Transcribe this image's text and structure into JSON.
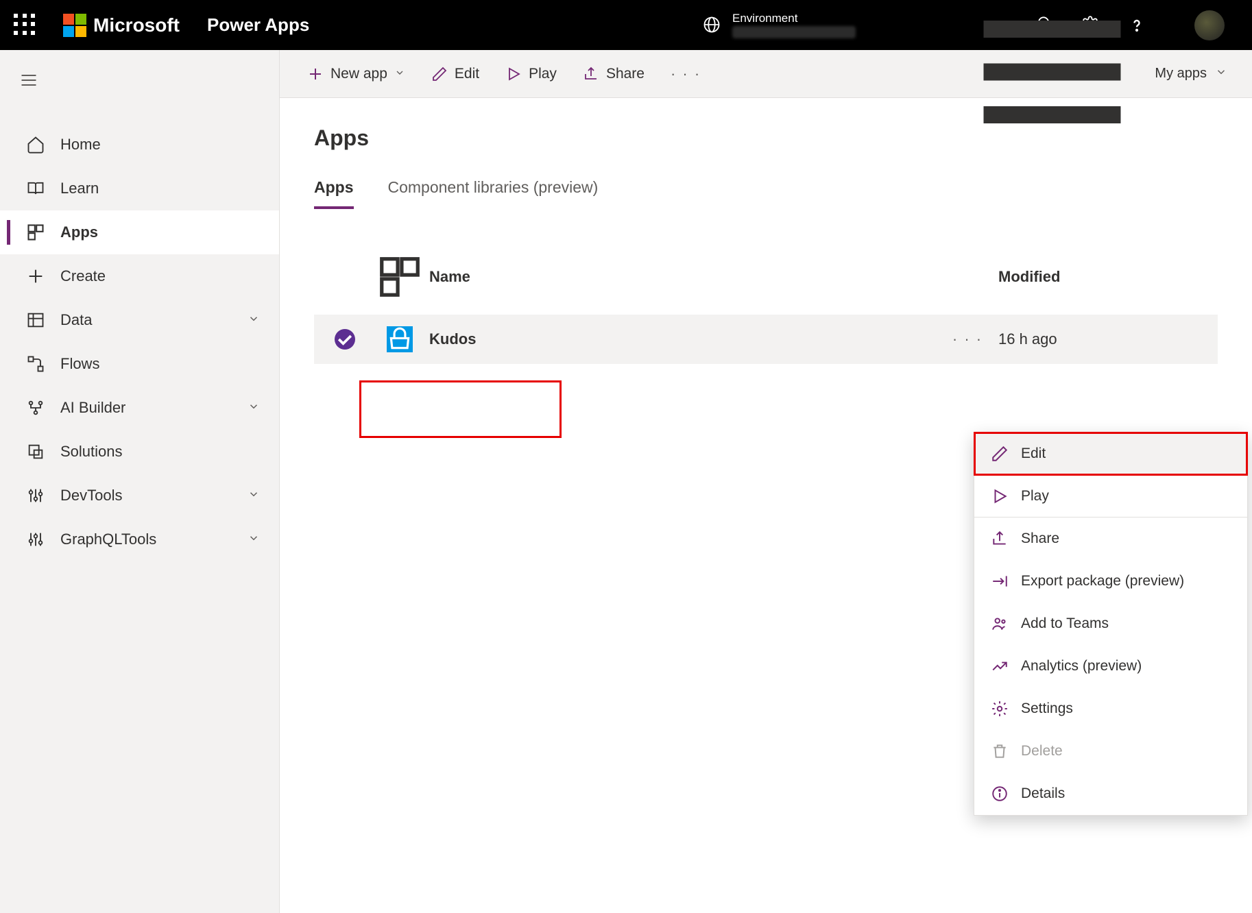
{
  "header": {
    "brand": "Microsoft",
    "product": "Power Apps",
    "environment_label": "Environment"
  },
  "sidebar": {
    "items": [
      {
        "label": "Home"
      },
      {
        "label": "Learn"
      },
      {
        "label": "Apps"
      },
      {
        "label": "Create"
      },
      {
        "label": "Data"
      },
      {
        "label": "Flows"
      },
      {
        "label": "AI Builder"
      },
      {
        "label": "Solutions"
      },
      {
        "label": "DevTools"
      },
      {
        "label": "GraphQLTools"
      }
    ]
  },
  "toolbar": {
    "new_app": "New app",
    "edit": "Edit",
    "play": "Play",
    "share": "Share",
    "view_filter": "My apps"
  },
  "page": {
    "title": "Apps",
    "tabs": {
      "apps": "Apps",
      "components": "Component libraries (preview)"
    }
  },
  "table": {
    "headers": {
      "name": "Name",
      "modified": "Modified"
    },
    "rows": [
      {
        "name": "Kudos",
        "modified": "16 h ago"
      }
    ]
  },
  "context_menu": {
    "edit": "Edit",
    "play": "Play",
    "share": "Share",
    "export": "Export package (preview)",
    "teams": "Add to Teams",
    "analytics": "Analytics (preview)",
    "settings": "Settings",
    "delete": "Delete",
    "details": "Details"
  }
}
